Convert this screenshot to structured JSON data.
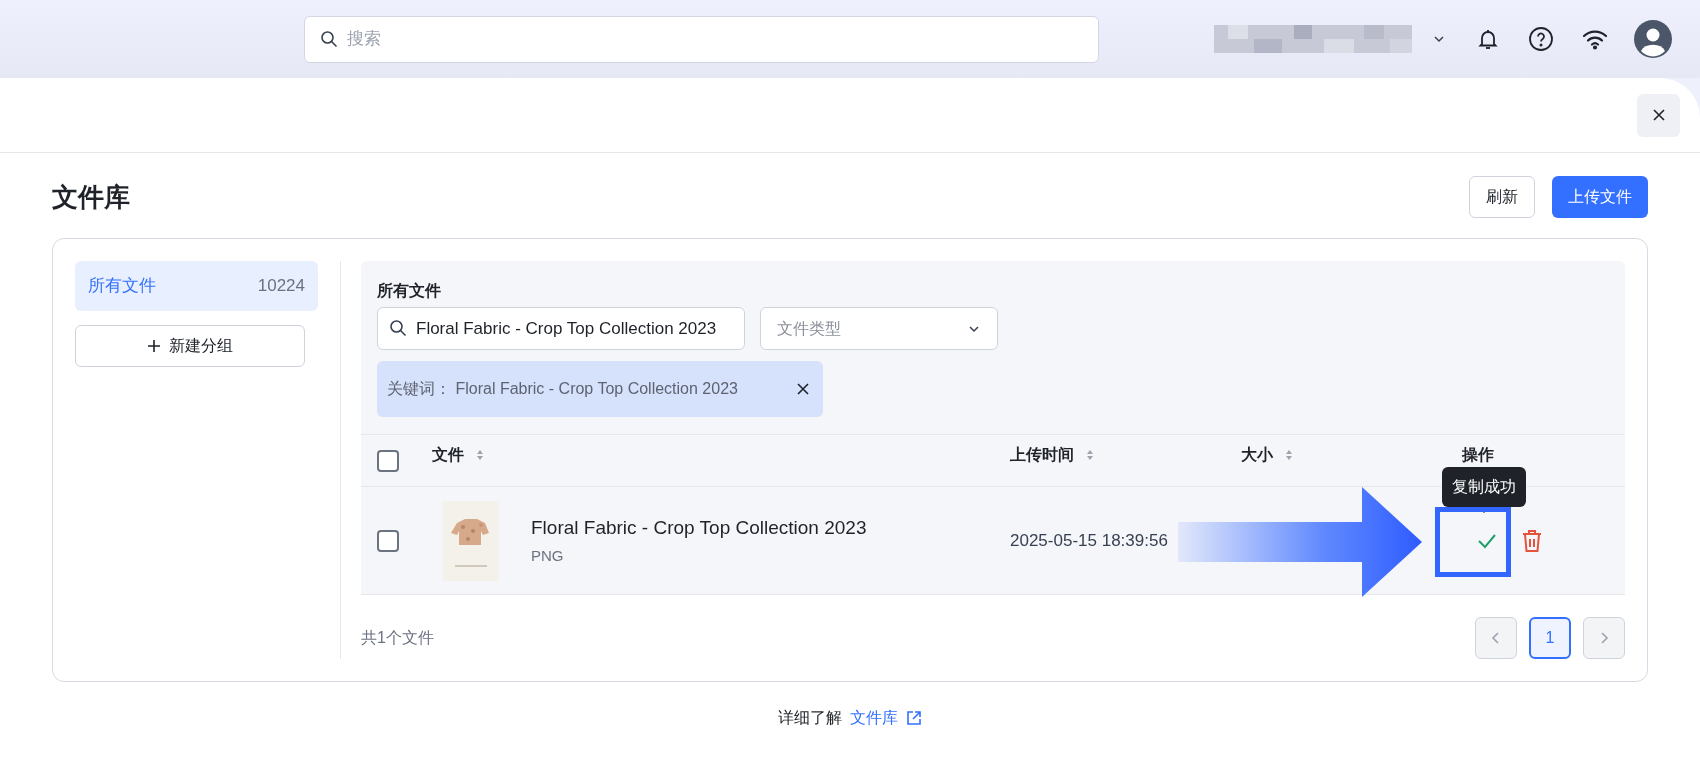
{
  "top_bar": {
    "search": {
      "placeholder": "搜索"
    },
    "account_redacted": true
  },
  "dialog": {
    "title": "文件库",
    "buttons": [
      {
        "label": "刷新",
        "kind": "secondary"
      },
      {
        "label": "上传文件",
        "kind": "primary"
      }
    ],
    "groups": [
      {
        "label": "所有文件",
        "count": "10224",
        "selected": true
      }
    ],
    "new_group_button": "新建分组",
    "filter": {
      "title": "所有文件",
      "search_value": "Floral Fabric - Crop Top Collection 2023",
      "type_placeholder": "文件类型",
      "tag": {
        "label": "关键词：",
        "value": "Floral Fabric - Crop Top Collection 2023"
      }
    },
    "table": {
      "select_all_checked": false,
      "columns": [
        {
          "label": "文件",
          "sortable": true
        },
        {
          "label": "上传时间",
          "sortable": true
        },
        {
          "label": "大小",
          "sortable": true
        },
        {
          "label": "操作",
          "sortable": false
        }
      ],
      "rows": [
        {
          "checked": false,
          "name": "Floral Fabric - Crop Top Collection 2023",
          "type": "PNG",
          "uploaded": "2025-05-15 18:39:56",
          "copied": true,
          "tooltip": "复制成功"
        }
      ]
    },
    "summary": "共1个文件",
    "pages": [
      {
        "label": "1",
        "selected": true
      }
    ],
    "help": {
      "text": "详细了解",
      "link": "文件库"
    }
  },
  "annotations": {
    "arrow": true,
    "highlight_frame": true
  }
}
